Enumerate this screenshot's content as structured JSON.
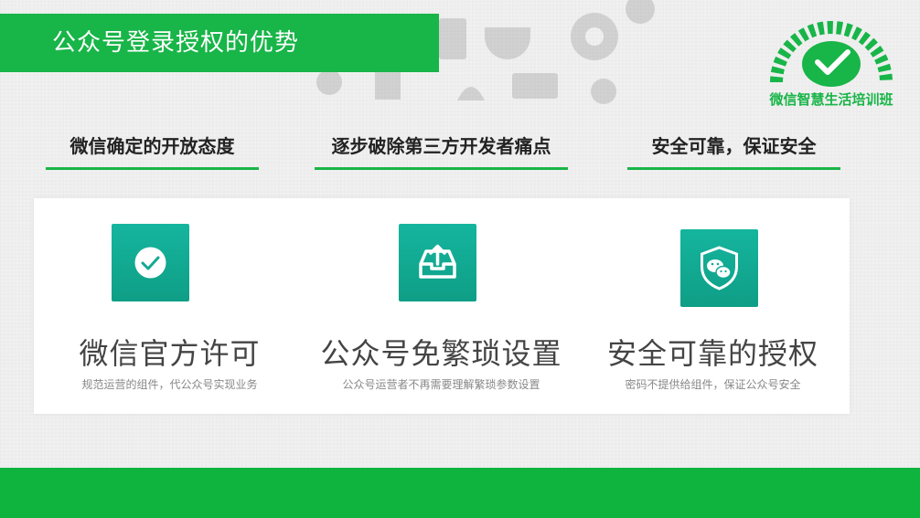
{
  "title": "公众号登录授权的优势",
  "logo": {
    "text": "微信智慧生活培训班",
    "icon": "wechat-logo-icon"
  },
  "headings": [
    "微信确定的开放态度",
    "逐步破除第三方开发者痛点",
    "安全可靠，保证安全"
  ],
  "features": [
    {
      "icon": "check-circle-icon",
      "title": "微信官方许可",
      "desc": "规范运营的组件，代公众号实现业务"
    },
    {
      "icon": "upload-tray-icon",
      "title": "公众号免繁琐设置",
      "desc": "公众号运营者不再需要理解繁琐参数设置"
    },
    {
      "icon": "shield-wechat-icon",
      "title": "安全可靠的授权",
      "desc": "密码不提供给组件，保证公众号安全"
    }
  ],
  "colors": {
    "brand_green": "#18b548",
    "icon_teal": "#13a993",
    "bottom_bar": "#0fb43e"
  }
}
